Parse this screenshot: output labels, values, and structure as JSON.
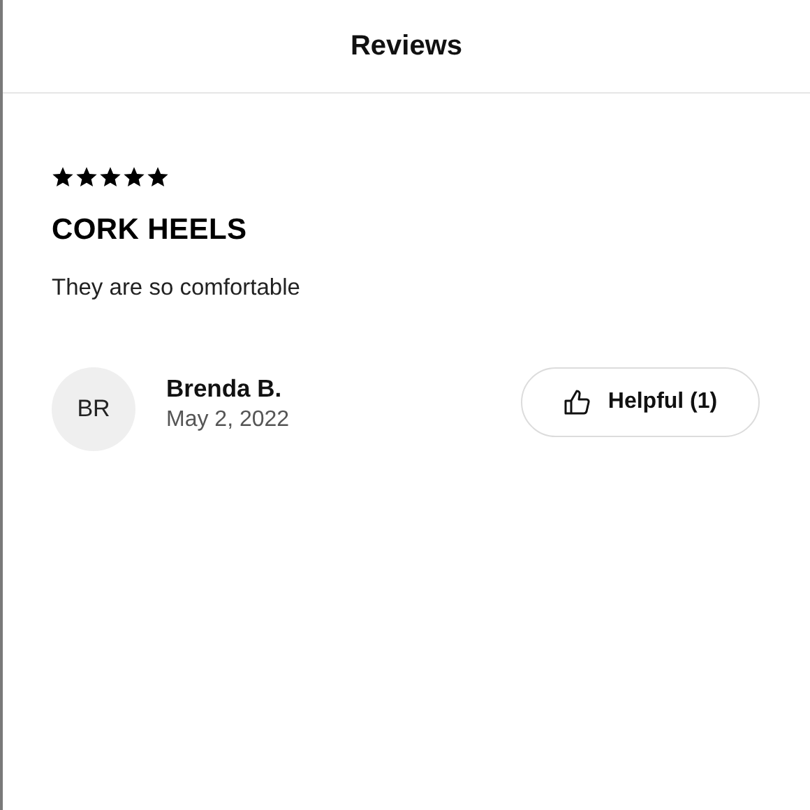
{
  "header": {
    "title": "Reviews"
  },
  "review": {
    "stars": 5,
    "title": "CORK HEELS",
    "body": "They are so comfortable",
    "author": {
      "initials": "BR",
      "name": "Brenda B.",
      "date": "May 2, 2022"
    },
    "helpful_button": {
      "label": "Helpful (1)"
    }
  }
}
